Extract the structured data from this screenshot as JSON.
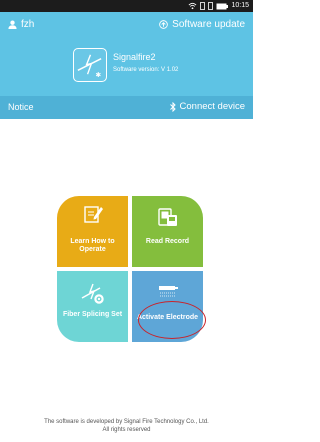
{
  "status_bar": {
    "time": "10:15"
  },
  "header": {
    "user_name": "fzh",
    "software_update_label": "Software update",
    "app_name": "Signalfire2",
    "software_version": "Software version: V 1.02"
  },
  "notice_bar": {
    "notice_label": "Notice",
    "connect_label": "Connect device"
  },
  "tiles": [
    {
      "label": "Learn How to Operate",
      "color": "#e8ab16"
    },
    {
      "label": "Read Record",
      "color": "#84be3d"
    },
    {
      "label": "Fiber Splicing Set",
      "color": "#6ed5d5"
    },
    {
      "label": "Activate Electrode",
      "color": "#5ea6d7"
    }
  ],
  "footer": {
    "line1": "The software is developed by Signal Fire Technology Co., Ltd.",
    "line2": "All rights reserved"
  },
  "colors": {
    "header_bg": "#5ec3e4",
    "notice_bg": "#4fb1d6",
    "highlight_ring": "#c9232a"
  }
}
